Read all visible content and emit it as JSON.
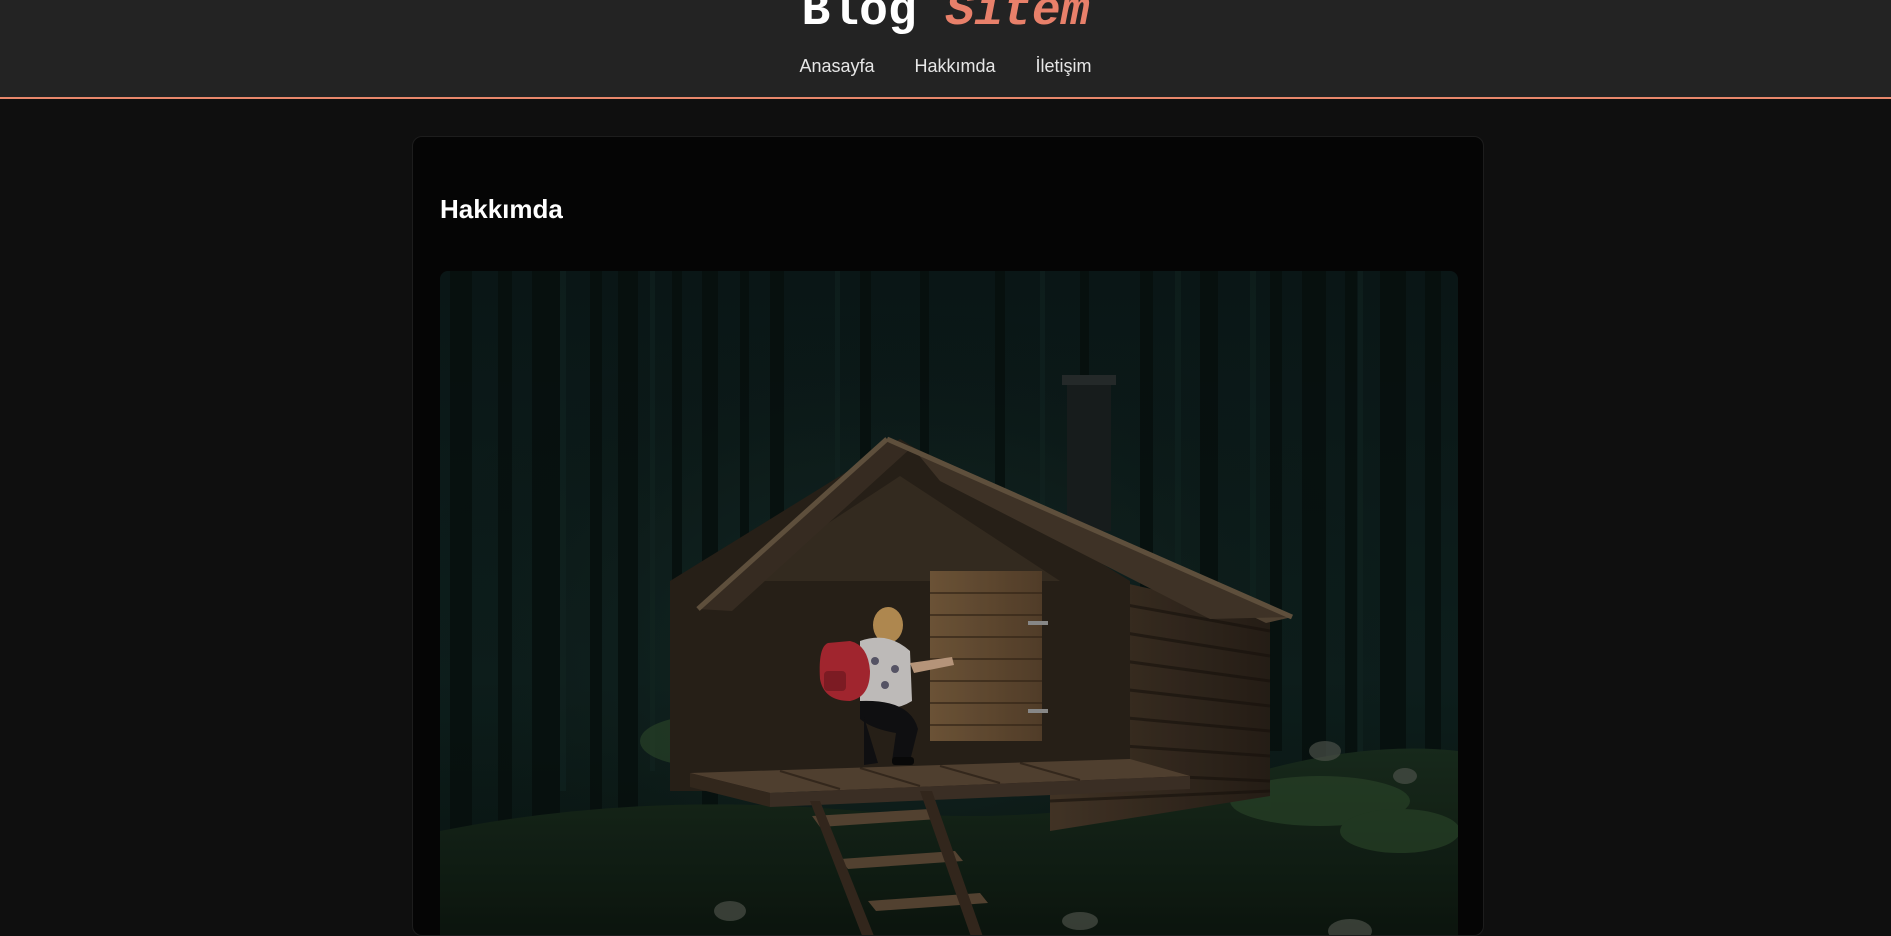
{
  "header": {
    "brand_main": "Blog",
    "brand_accent": "Sitem",
    "accent_color": "#e8806a",
    "nav": [
      {
        "label": "Anasayfa"
      },
      {
        "label": "Hakkımda"
      },
      {
        "label": "İletişim"
      }
    ]
  },
  "page": {
    "title": "Hakkımda"
  }
}
